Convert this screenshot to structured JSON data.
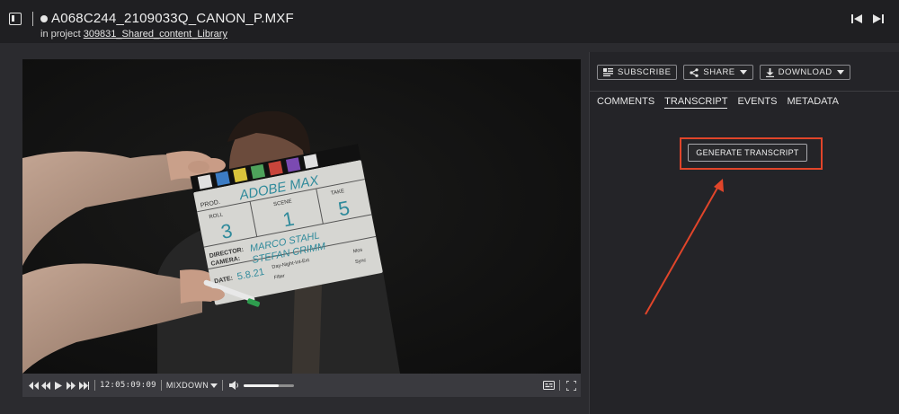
{
  "header": {
    "file_name": "A068C244_2109033Q_CANON_P.MXF",
    "project_prefix": "in project ",
    "project_name": "309831_Shared_content_Library",
    "icons": [
      "sidebar-toggle-icon",
      "status-dot-icon",
      "previous-asset-icon",
      "next-asset-icon"
    ]
  },
  "video": {
    "slate": {
      "title": "ADOBE MAX",
      "prod_label": "PROD.",
      "roll_label": "ROLL",
      "scene_label": "SCENE",
      "take_label": "TAKE",
      "roll": "3",
      "scene": "1",
      "take": "5",
      "director_label": "DIRECTOR:",
      "director": "MARCO STAHL",
      "camera_label": "CAMERA:",
      "camera": "STEFAN CRIMM",
      "date_label": "DATE:",
      "date": "5.8.21",
      "day_night": "Day-Night-Int-Ext",
      "mos": "Mos",
      "filter": "Filter",
      "sync": "Sync"
    }
  },
  "player": {
    "timecode": "12:05:09:09",
    "audio_mode": "MIXDOWN",
    "volume": 0.7,
    "icons": [
      "skip-to-start-icon",
      "rewind-icon",
      "play-icon",
      "fast-forward-icon",
      "skip-to-end-icon",
      "volume-icon",
      "subtitles-icon",
      "fullscreen-icon"
    ]
  },
  "panel": {
    "actions": {
      "subscribe": "SUBSCRIBE",
      "share": "SHARE",
      "download": "DOWNLOAD"
    },
    "tabs": [
      {
        "label": "COMMENTS",
        "active": false
      },
      {
        "label": "TRANSCRIPT",
        "active": true
      },
      {
        "label": "EVENTS",
        "active": false
      },
      {
        "label": "METADATA",
        "active": false
      }
    ],
    "generate_transcript": "GENERATE TRANSCRIPT"
  },
  "colors": {
    "background": "#1f1f22",
    "panel": "#242428",
    "annotation": "#e1452a"
  }
}
